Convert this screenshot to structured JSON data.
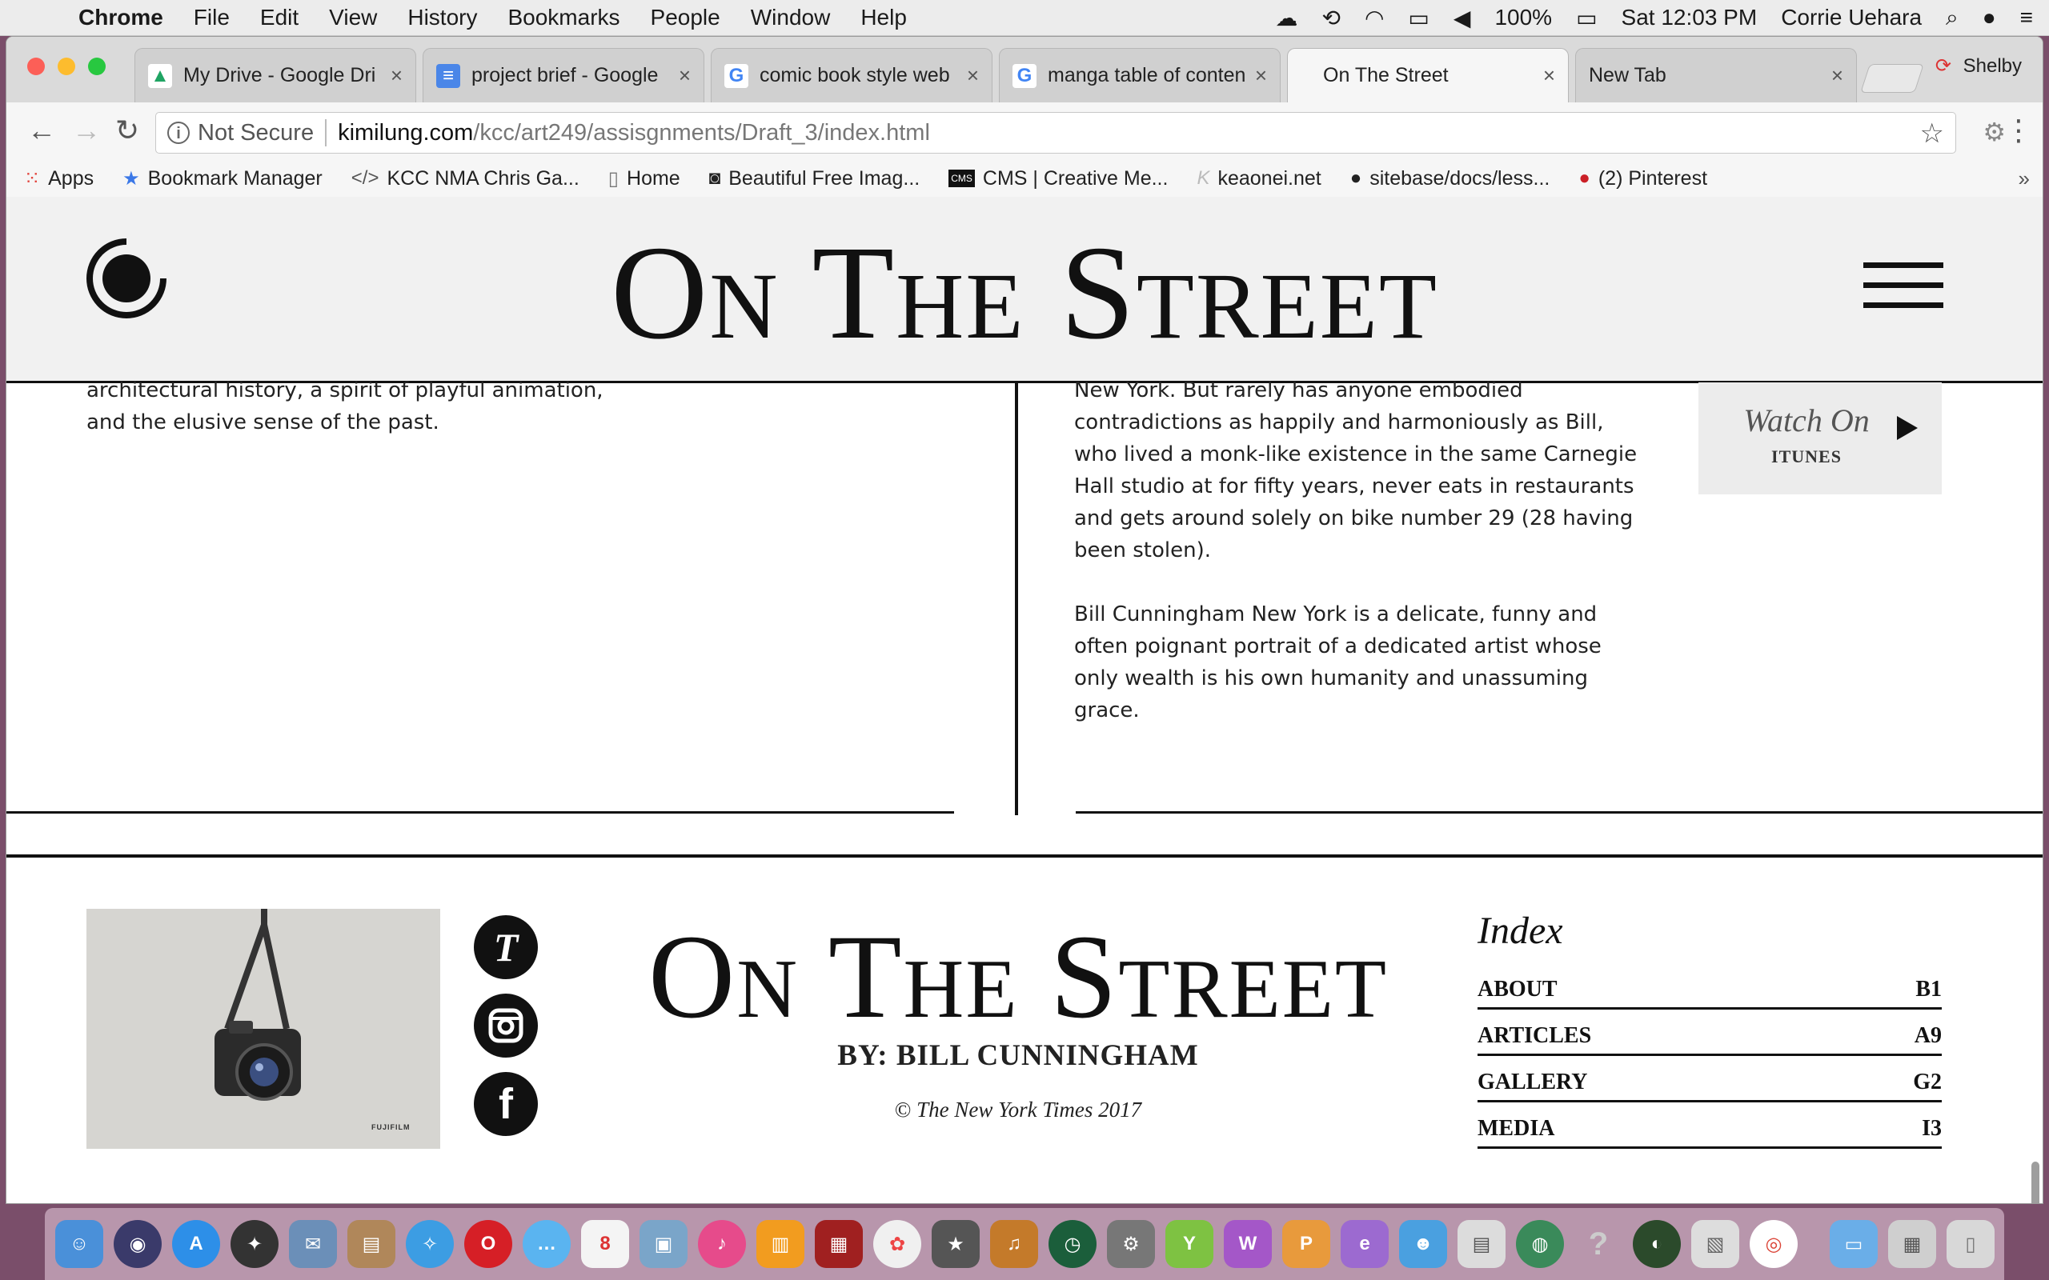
{
  "menubar": {
    "app": "Chrome",
    "items": [
      "File",
      "Edit",
      "View",
      "History",
      "Bookmarks",
      "People",
      "Window",
      "Help"
    ],
    "battery": "100%",
    "clock": "Sat 12:03 PM",
    "user": "Corrie Uehara"
  },
  "tabs": [
    {
      "title": "My Drive - Google Dri",
      "icon": "google-drive-icon"
    },
    {
      "title": "project brief - Google",
      "icon": "google-docs-icon"
    },
    {
      "title": "comic book style web",
      "icon": "google-icon"
    },
    {
      "title": "manga table of conten",
      "icon": "google-icon"
    },
    {
      "title": "On The Street",
      "icon": "none"
    },
    {
      "title": "New Tab",
      "icon": "none"
    }
  ],
  "profile_name": "Shelby",
  "address": {
    "security": "Not Secure",
    "host": "kimilung.com",
    "path": "/kcc/art249/assisgnments/Draft_3/index.html"
  },
  "bookmarks": [
    {
      "label": "Apps",
      "icon": "apps-grid-icon"
    },
    {
      "label": "Bookmark Manager",
      "icon": "star-icon"
    },
    {
      "label": "KCC NMA Chris Ga...",
      "icon": "code-icon"
    },
    {
      "label": "Home",
      "icon": "page-icon"
    },
    {
      "label": "Beautiful Free Imag...",
      "icon": "camera-icon"
    },
    {
      "label": "CMS | Creative Me...",
      "icon": "cms-icon"
    },
    {
      "label": "keaonei.net",
      "icon": "k-icon"
    },
    {
      "label": "sitebase/docs/less...",
      "icon": "github-icon"
    },
    {
      "label": "(2) Pinterest",
      "icon": "pinterest-icon"
    }
  ],
  "site": {
    "title": "On The Street",
    "left_text": "architectural history, a spirit of playful animation, and the elusive sense of the past.",
    "right_paragraphs": [
      "New York. But rarely has anyone embodied contradictions as happily and harmoniously as Bill, who lived a monk-like existence in the same Carnegie Hall studio at for fifty years, never eats in restaurants and gets around solely on bike number 29 (28 having been stolen).",
      "Bill Cunningham New York is a delicate, funny and often poignant portrait of a dedicated artist whose only wealth is his own humanity and unassuming grace."
    ],
    "watch": {
      "line1": "Watch On",
      "line2": "ITUNES"
    }
  },
  "footer": {
    "title": "On The Street",
    "byline": "BY: BILL CUNNINGHAM",
    "copyright": "The New York Times 2017",
    "ad_brand": "FUJIFILM",
    "social": [
      "nyt-icon",
      "instagram-icon",
      "facebook-icon"
    ],
    "index_title": "Index",
    "index": [
      {
        "label": "ABOUT",
        "code": "B1"
      },
      {
        "label": "ARTICLES",
        "code": "A9"
      },
      {
        "label": "GALLERY",
        "code": "G2"
      },
      {
        "label": "MEDIA",
        "code": "I3"
      }
    ]
  },
  "colors": {
    "header_bg": "#f1f1f1",
    "ink": "#111111",
    "watch_bg": "#ececec",
    "ad_bg": "#d6d5d1"
  }
}
